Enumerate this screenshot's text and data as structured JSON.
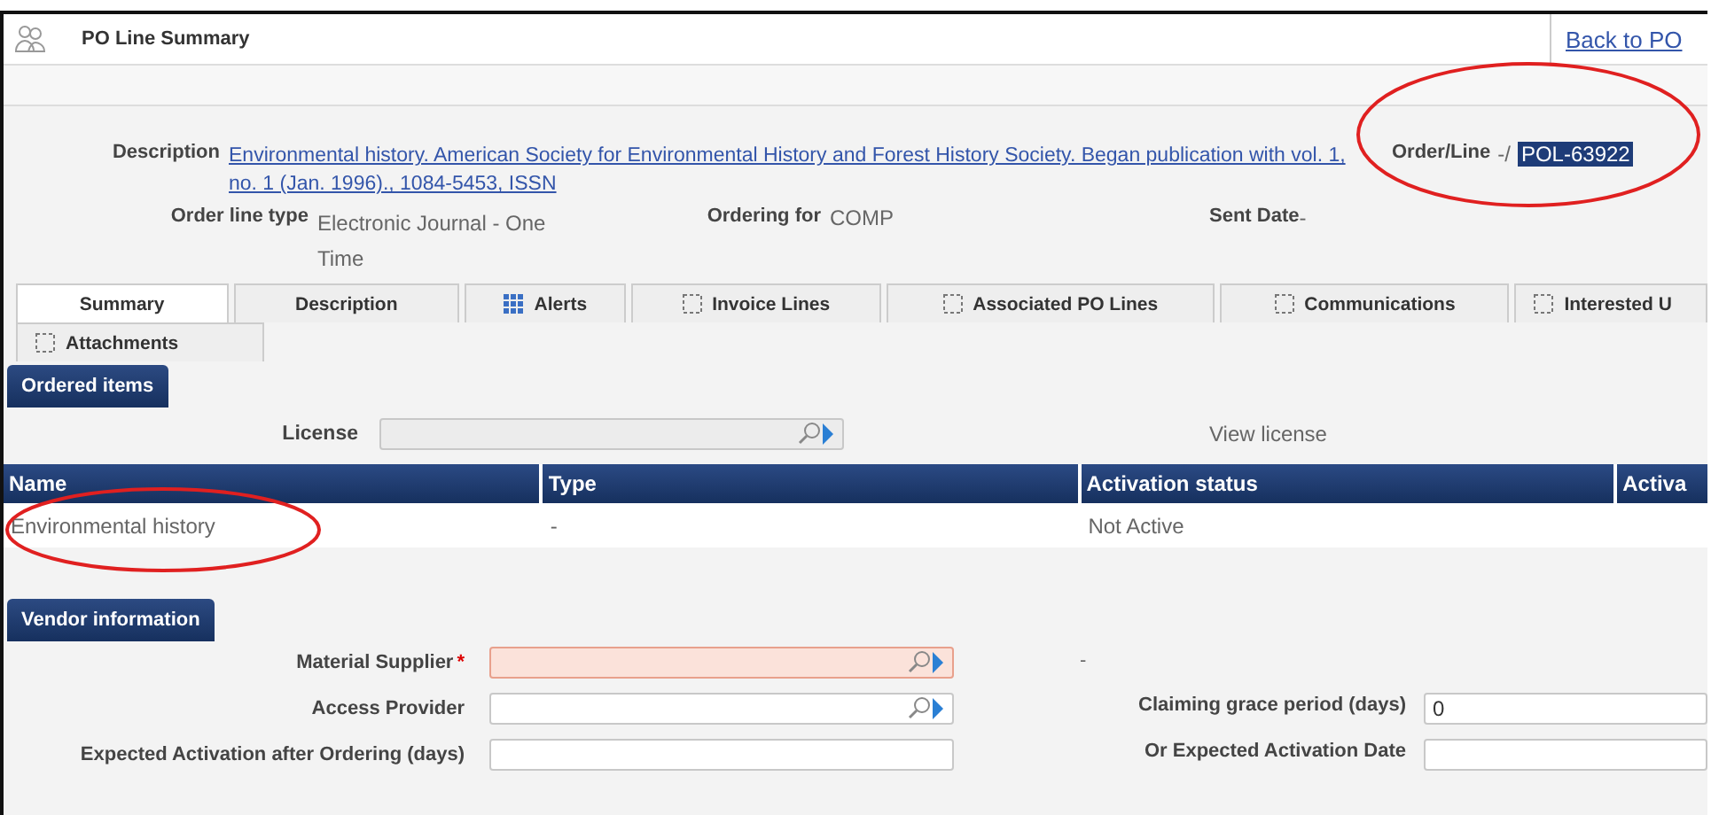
{
  "header": {
    "title": "PO Line Summary",
    "back_link": "Back to PO"
  },
  "details": {
    "description_label": "Description",
    "description": "Environmental history. American Society for Environmental History and Forest History Society. Began publication with vol. 1, no. 1 (Jan. 1996)., 1084-5453, ISSN",
    "order_line_label": "Order/Line",
    "order_line_prefix": "-/",
    "order_line": "POL-63922",
    "order_line_type_label": "Order line type",
    "order_line_type": "Electronic Journal - One Time",
    "ordering_for_label": "Ordering for",
    "ordering_for": "COMP",
    "sent_date_label": "Sent Date",
    "sent_date": "-"
  },
  "tabs": [
    {
      "label": "Summary",
      "selected": true,
      "kind": "plain"
    },
    {
      "label": "Description",
      "selected": false,
      "kind": "plain"
    },
    {
      "label": "Alerts",
      "selected": false,
      "kind": "grid"
    },
    {
      "label": "Invoice Lines",
      "selected": false,
      "kind": "dotted"
    },
    {
      "label": "Associated PO Lines",
      "selected": false,
      "kind": "dotted"
    },
    {
      "label": "Communications",
      "selected": false,
      "kind": "dotted"
    },
    {
      "label": "Interested U",
      "selected": false,
      "kind": "dotted"
    },
    {
      "label": "Attachments",
      "selected": false,
      "kind": "dotted"
    }
  ],
  "ordered_items": {
    "title": "Ordered items",
    "license_label": "License",
    "view_license": "View license",
    "columns": [
      "Name",
      "Type",
      "Activation status",
      "Activa"
    ],
    "rows": [
      [
        "Environmental history",
        "-",
        "Not Active",
        ""
      ]
    ]
  },
  "vendor": {
    "title": "Vendor information",
    "fields": [
      {
        "label": "Material Supplier",
        "required_mark": "*",
        "invalid": true,
        "kind": "lookup"
      },
      {
        "label": "Access Provider",
        "invalid": false,
        "kind": "lookup"
      },
      {
        "label": "Expected Activation after Ordering (days)",
        "invalid": false,
        "kind": "plain"
      }
    ],
    "right": [
      {
        "kind": "text",
        "value": "-"
      },
      {
        "kind": "field",
        "label": "Claiming grace period (days)",
        "value": "0"
      },
      {
        "kind": "field",
        "label": "Or Expected Activation Date"
      }
    ]
  }
}
